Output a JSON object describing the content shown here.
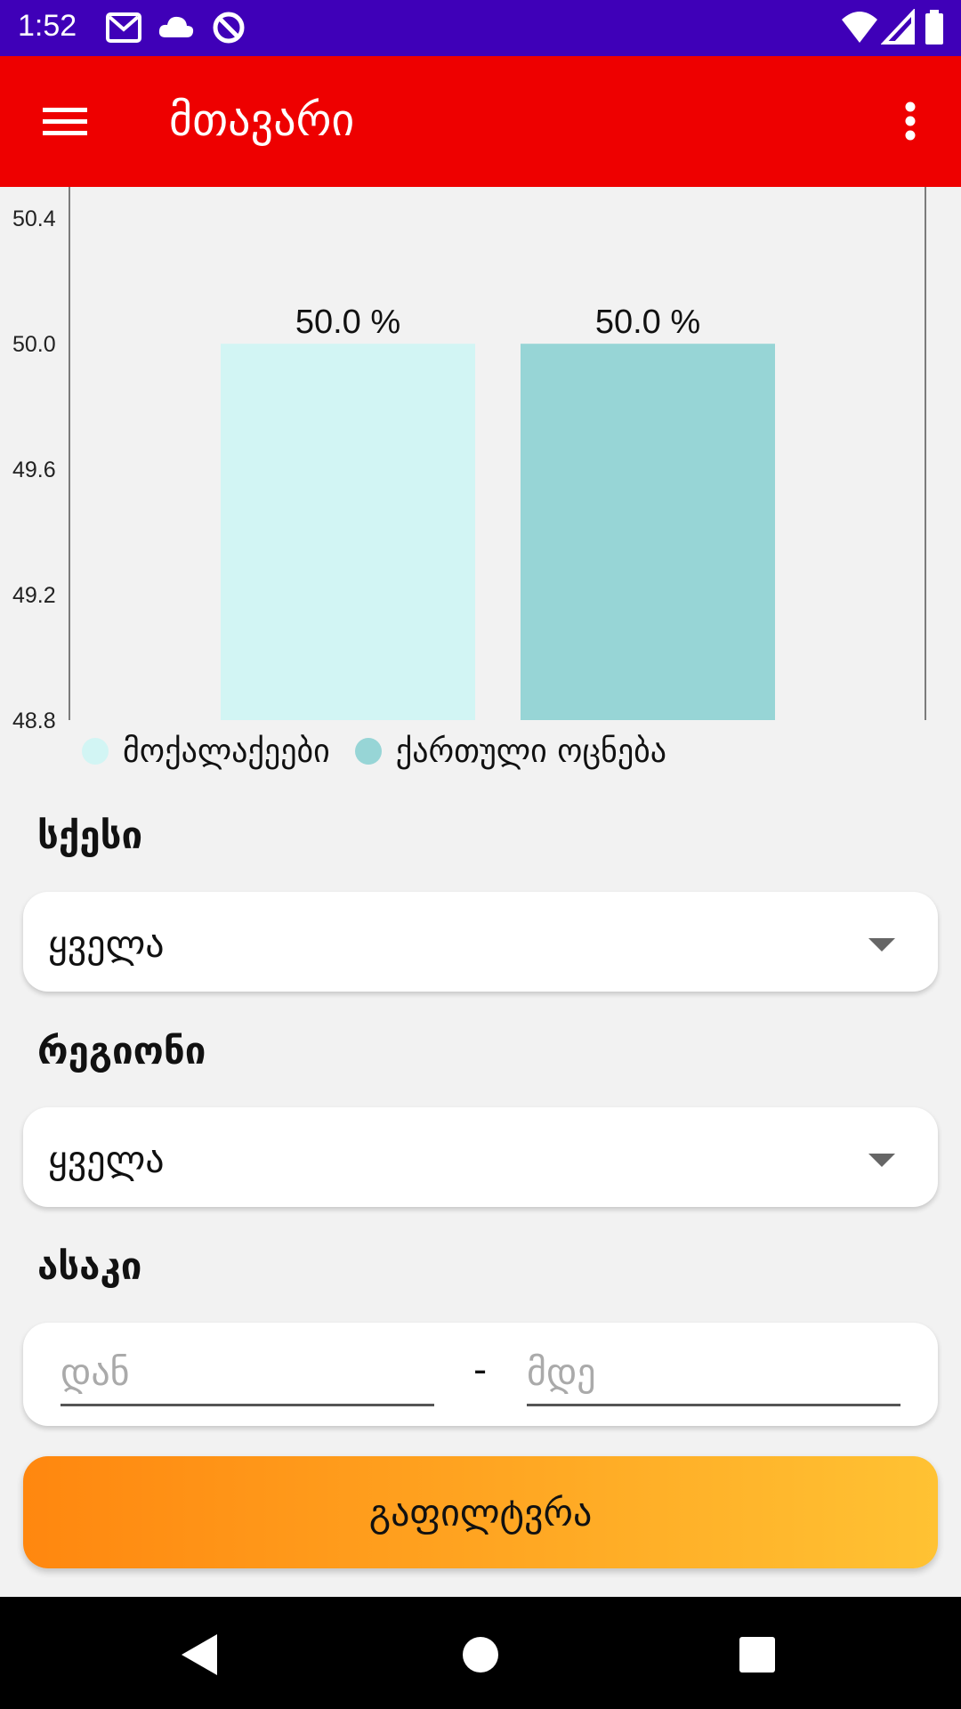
{
  "status_bar": {
    "time": "1:52",
    "icons": [
      "gmail-icon",
      "cloud-icon",
      "sync-icon",
      "wifi-icon",
      "signal-icon",
      "battery-icon"
    ]
  },
  "app_bar": {
    "title": "მთავარი",
    "menu_icon": "hamburger-menu-icon",
    "overflow_icon": "more-vert-icon",
    "background": "#ee0000"
  },
  "chart_data": {
    "type": "bar",
    "categories": [
      "მოქალაქეები",
      "ქართული ოცნება"
    ],
    "series": [
      {
        "name": "მოქალაქეები",
        "values": [
          50.0
        ],
        "color": "#d2f5f4"
      },
      {
        "name": "ქართული ოცნება",
        "values": [
          50.0
        ],
        "color": "#97d5d6"
      }
    ],
    "data_labels": [
      "50.0 %",
      "50.0 %"
    ],
    "y_ticks": [
      "50.4",
      "50.0",
      "49.6",
      "49.2",
      "48.8"
    ],
    "ylim": [
      48.8,
      50.5
    ],
    "grid": false,
    "legend_position": "bottom-left"
  },
  "filters": {
    "gender": {
      "label": "სქესი",
      "value": "ყველა"
    },
    "region": {
      "label": "რეგიონი",
      "value": "ყველა"
    },
    "age": {
      "label": "ასაკი",
      "from_placeholder": "დან",
      "separator": "-",
      "to_placeholder": "მდე"
    },
    "submit_label": "გაფილტვრა"
  },
  "nav_bar": {
    "icons": [
      "back-icon",
      "home-icon",
      "recents-icon"
    ]
  }
}
